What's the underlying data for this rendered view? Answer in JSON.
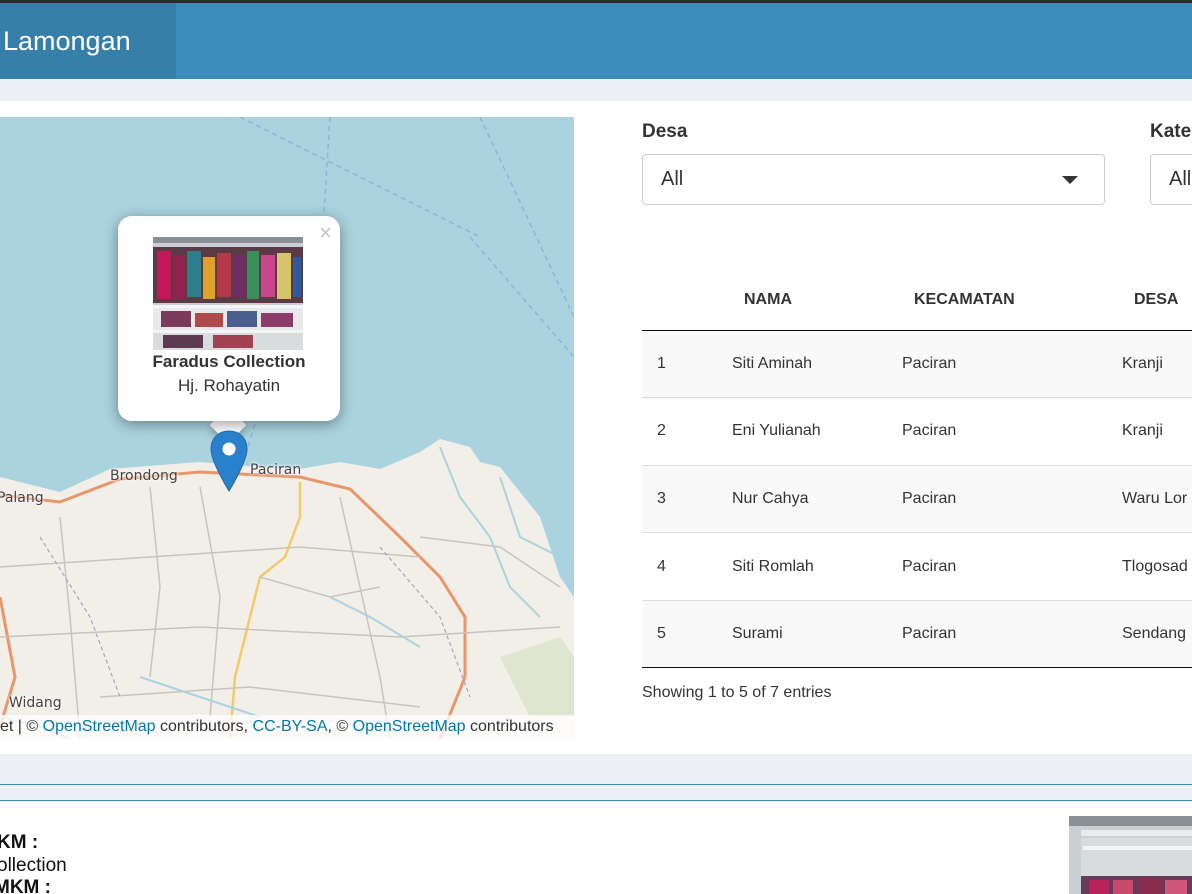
{
  "header": {
    "title": "Lamongan"
  },
  "map": {
    "places": [
      "Brondong",
      "Paciran",
      "Palang",
      "Widang"
    ],
    "popup": {
      "title": "Faradus Collection",
      "subtitle": "Hj. Rohayatin",
      "close": "×"
    },
    "attribution": {
      "prefix": "et | © ",
      "link1": "OpenStreetMap",
      "text1": " contributors, ",
      "link2": "CC-BY-SA",
      "text2": ", © ",
      "link3": "OpenStreetMap",
      "text3": " contributors"
    }
  },
  "filters": {
    "desa": {
      "label": "Desa",
      "value": "All"
    },
    "kategori": {
      "label": "Kate",
      "value": "All"
    }
  },
  "table": {
    "columns": [
      "",
      "NAMA",
      "KECAMATAN",
      "DESA"
    ],
    "rows": [
      [
        "1",
        "Siti Aminah",
        "Paciran",
        "Kranji"
      ],
      [
        "2",
        "Eni Yulianah",
        "Paciran",
        "Kranji"
      ],
      [
        "3",
        "Nur Cahya",
        "Paciran",
        "Waru Lor"
      ],
      [
        "4",
        "Siti Romlah",
        "Paciran",
        "Tlogosad"
      ],
      [
        "5",
        "Surami",
        "Paciran",
        "Sendang"
      ]
    ],
    "info": "Showing 1 to 5 of 7 entries"
  },
  "detail": {
    "line1": "KM :",
    "line2": "ollection",
    "line3": "MKM :"
  },
  "colors": {
    "header": "#3c8dbc",
    "brand": "#367fa9",
    "link": "#0078a8",
    "marker": "#2a81cb"
  }
}
